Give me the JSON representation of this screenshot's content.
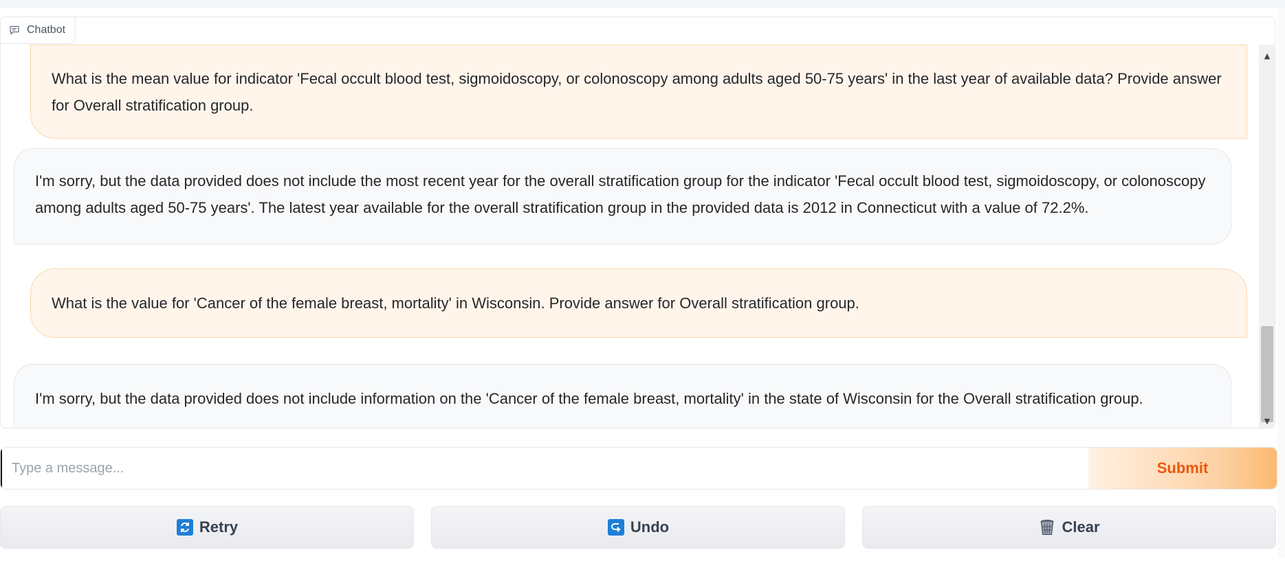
{
  "chatbot": {
    "label": "Chatbot",
    "icon": "chat-bubble-icon",
    "messages": [
      {
        "role": "user",
        "text": "What is the mean value for indicator 'Fecal occult blood test, sigmoidoscopy, or colonoscopy among adults aged 50-75 years' in the last year of available data? Provide answer for Overall stratification group."
      },
      {
        "role": "bot",
        "text": "I'm sorry, but the data provided does not include the most recent year for the overall stratification group for the indicator 'Fecal occult blood test, sigmoidoscopy, or colonoscopy among adults aged 50-75 years'. The latest year available for the overall stratification group in the provided data is 2012 in Connecticut with a value of 72.2%."
      },
      {
        "role": "user",
        "text": "What is the value for 'Cancer of the female breast, mortality' in Wisconsin. Provide answer for Overall stratification group."
      },
      {
        "role": "bot",
        "text": "I'm sorry, but the data provided does not include information on the 'Cancer of the female breast, mortality' in the state of Wisconsin for the Overall stratification group."
      }
    ]
  },
  "input": {
    "value": "",
    "placeholder": "Type a message..."
  },
  "submit": {
    "label": "Submit"
  },
  "actions": {
    "retry": {
      "label": "Retry",
      "icon": "retry-icon"
    },
    "undo": {
      "label": "Undo",
      "icon": "undo-icon"
    },
    "clear": {
      "label": "Clear",
      "icon": "wastebasket-icon"
    }
  },
  "colors": {
    "accent": "#ea580c",
    "user_bubble": "#fff5eb",
    "bot_bubble": "#f8f9fb"
  }
}
